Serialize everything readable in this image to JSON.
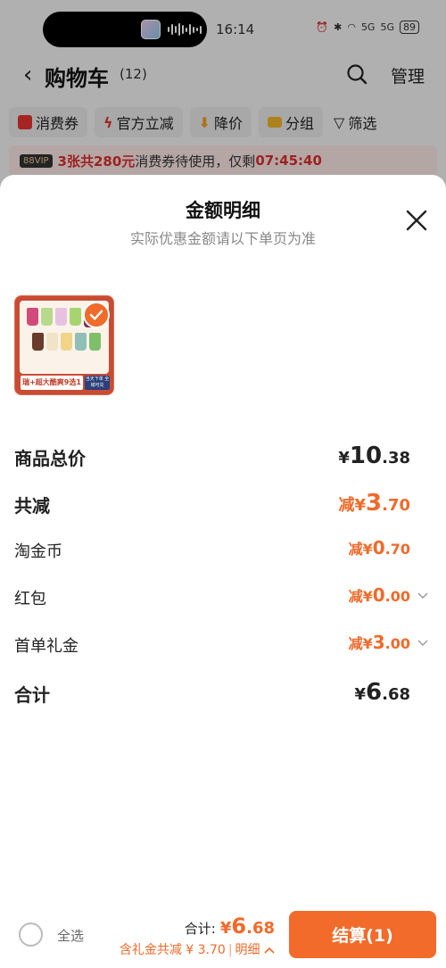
{
  "status_bar": {
    "time": "16:14",
    "network": "5G",
    "battery": "89"
  },
  "nav": {
    "title": "购物车",
    "count": "(12)",
    "manage": "管理"
  },
  "filters": [
    "消费券",
    "官方立减",
    "降价",
    "分组",
    "筛选"
  ],
  "promo": {
    "vip": "88VIP",
    "highlight": "3张共280元",
    "text": "消费券待使用，仅剩",
    "countdown": "07:45:40"
  },
  "sheet": {
    "title": "金额明细",
    "subtitle": "实际优惠金额请以下单页为准",
    "product": {
      "label": "瑞+超大酷爽9选1",
      "tag": "当天下单 全城可兑"
    },
    "rows": {
      "total_price": {
        "label": "商品总价",
        "prefix": "¥",
        "int": "10",
        "dec": ".38"
      },
      "total_discount": {
        "label": "共减",
        "prefix": "减¥",
        "int": "3",
        "dec": ".70"
      },
      "coins": {
        "label": "淘金币",
        "prefix": "减¥",
        "int": "0",
        "dec": ".70"
      },
      "red_packet": {
        "label": "红包",
        "prefix": "减¥",
        "int": "0",
        "dec": ".00"
      },
      "first_order": {
        "label": "首单礼金",
        "prefix": "减¥",
        "int": "3",
        "dec": ".00"
      },
      "sum": {
        "label": "合计",
        "prefix": "¥",
        "int": "6",
        "dec": ".68"
      }
    }
  },
  "footer": {
    "select_all": "全选",
    "total_label": "合计:",
    "total_prefix": "¥",
    "total_int": "6",
    "total_dec": ".68",
    "discount_text": "含礼金共减 ¥ 3.70",
    "detail": "明细",
    "checkout": "结算(1)"
  },
  "colors": {
    "accent": "#f26b2a",
    "promo_red": "#d9302b"
  }
}
